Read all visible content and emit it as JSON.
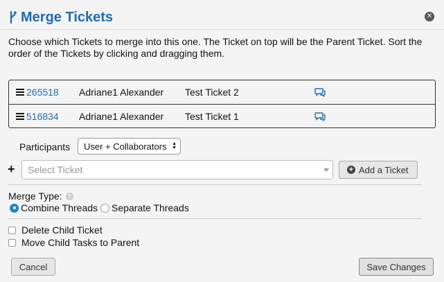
{
  "dialog": {
    "title": "Merge Tickets",
    "title_icon": "merge-branch-icon",
    "close_icon": "close-icon",
    "description": "Choose which Tickets to merge into this one. The Ticket on top will be the Parent Ticket. Sort the order of the Tickets by clicking and dragging them.",
    "accent_color": "#1f6bb3"
  },
  "tickets": [
    {
      "id": "265518",
      "user": "Adriane1 Alexander",
      "subject": "Test Ticket 2"
    },
    {
      "id": "516834",
      "user": "Adriane1 Alexander",
      "subject": "Test Ticket 1"
    }
  ],
  "participants": {
    "label": "Participants",
    "selected": "User + Collaborators"
  },
  "add_ticket": {
    "placeholder": "Select Ticket",
    "button_label": "Add a Ticket"
  },
  "merge_type": {
    "label": "Merge Type:",
    "options": [
      "Combine Threads",
      "Separate Threads"
    ],
    "selected": "Combine Threads"
  },
  "options": {
    "delete_child": "Delete Child Ticket",
    "move_tasks": "Move Child Tasks to Parent"
  },
  "footer": {
    "cancel_label": "Cancel",
    "save_label": "Save Changes"
  }
}
